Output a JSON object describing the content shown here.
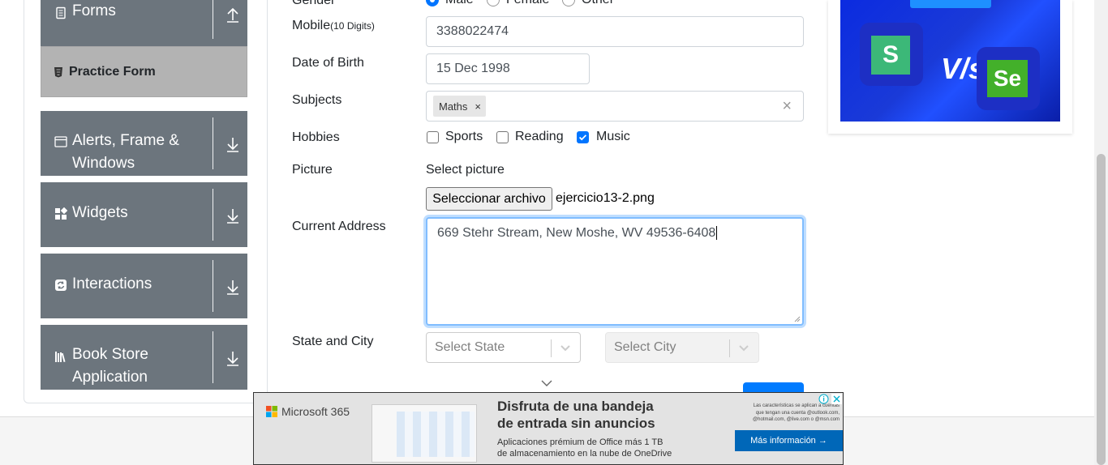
{
  "sidebar": {
    "groups": [
      {
        "label": "Forms",
        "icon": "form-icon",
        "arrow": "collapse-arrow-icon"
      },
      {
        "label": "Alerts, Frame & Windows",
        "icon": "window-icon",
        "arrow": "expand-arrow-icon"
      },
      {
        "label": "Widgets",
        "icon": "widgets-icon",
        "arrow": "expand-arrow-icon"
      },
      {
        "label": "Interactions",
        "icon": "interactions-icon",
        "arrow": "expand-arrow-icon"
      },
      {
        "label": "Book Store Application",
        "icon": "book-store-icon",
        "arrow": "expand-arrow-icon"
      }
    ],
    "active_item": {
      "label": "Practice Form",
      "icon": "html-icon"
    }
  },
  "form": {
    "gender": {
      "label": "Gender",
      "options": [
        "Male",
        "Female",
        "Other"
      ],
      "selected": "Male"
    },
    "mobile": {
      "label": "Mobile",
      "hint": "(10 Digits)",
      "value": "3388022474"
    },
    "dob": {
      "label": "Date of Birth",
      "value": "15 Dec 1998"
    },
    "subjects": {
      "label": "Subjects",
      "tags": [
        "Maths"
      ],
      "clear": "×",
      "tag_remove": "×"
    },
    "hobbies": {
      "label": "Hobbies",
      "options": [
        {
          "label": "Sports",
          "checked": false
        },
        {
          "label": "Reading",
          "checked": false
        },
        {
          "label": "Music",
          "checked": true
        }
      ]
    },
    "picture": {
      "label": "Picture",
      "select_label": "Select picture",
      "button": "Seleccionar archivo",
      "file_name": "ejercicio13-2.png"
    },
    "address": {
      "label": "Current Address",
      "value": "669 Stehr Stream, New Moshe, WV 49536-6408"
    },
    "state_city": {
      "label": "State and City",
      "state_placeholder": "Select State",
      "city_placeholder": "Select City"
    }
  },
  "ads": {
    "right_banner": {
      "vs_text": "V/s",
      "logo_left": "S",
      "logo_right": "Se"
    },
    "bottom": {
      "brand": "Microsoft 365",
      "headline_1": "Disfruta de una bandeja",
      "headline_2": "de entrada sin anuncios",
      "sub_1": "Aplicaciones prémium de Office más 1 TB",
      "sub_2": "de almacenamiento en la nube de OneDrive",
      "fine_1": "Las características se aplican a cuentas",
      "fine_2": "que tengan una cuenta @outlook.com,",
      "fine_3": "@hotmail.com, @live.com o @msn.com",
      "cta": "Más información →"
    }
  },
  "colors": {
    "sidebar": "#6c757d",
    "active": "#b3b3b3",
    "accent": "#0075ff",
    "focus": "#80bdff"
  }
}
